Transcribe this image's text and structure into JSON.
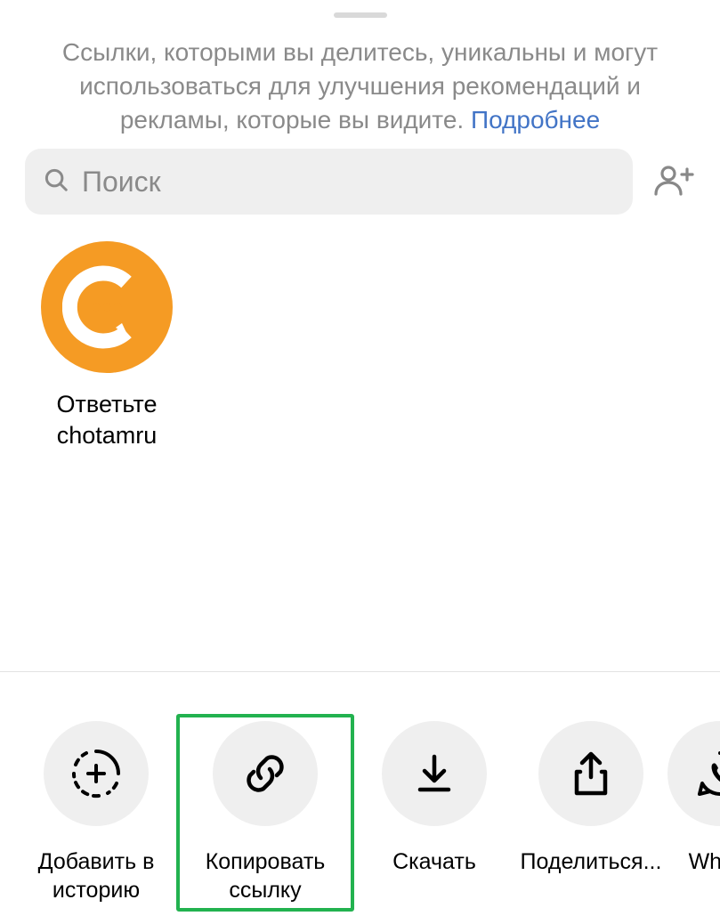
{
  "sheet": {
    "info_text_part1": "Ссылки, которыми вы делитесь, уникальны и могут использоваться для улучшения рекомендаций и рекламы, которые вы видите. ",
    "info_link": "Подробнее"
  },
  "search": {
    "placeholder": "Поиск"
  },
  "contacts": [
    {
      "label_line1": "Ответьте",
      "label_line2": "chotamru",
      "avatar_bg": "#f59b24"
    }
  ],
  "actions": [
    {
      "label": "Добавить в историю",
      "icon": "add-story"
    },
    {
      "label": "Копировать ссылку",
      "icon": "link",
      "highlighted": true
    },
    {
      "label": "Скачать",
      "icon": "download"
    },
    {
      "label": "Поделиться...",
      "icon": "share"
    },
    {
      "label": "Whats",
      "icon": "whatsapp"
    }
  ]
}
